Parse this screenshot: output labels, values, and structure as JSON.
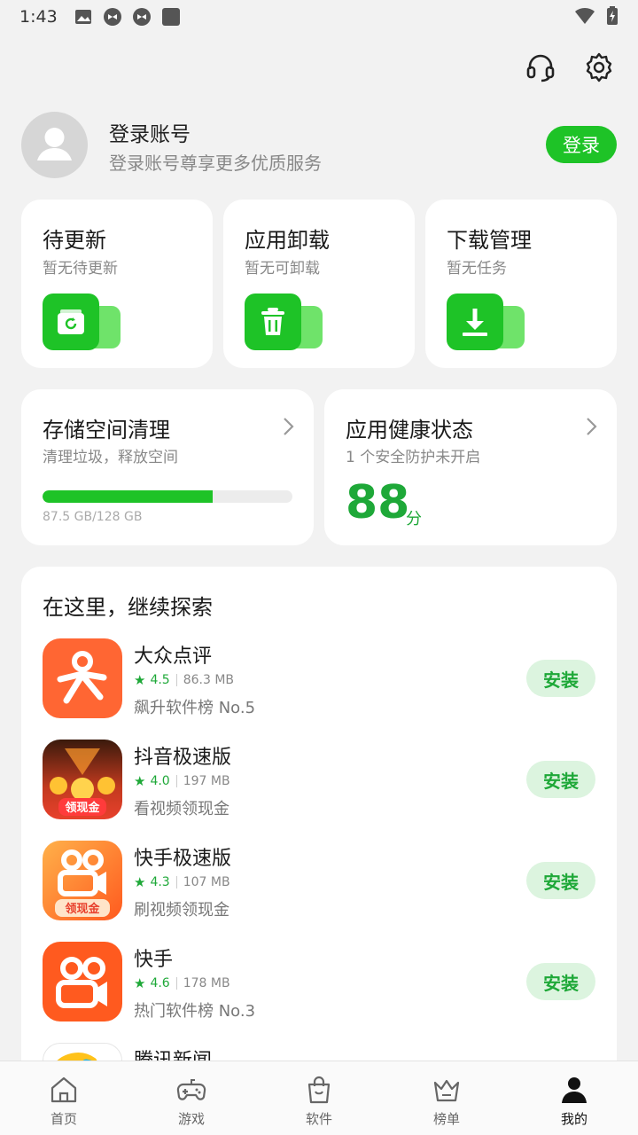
{
  "status_bar": {
    "time": "1:43",
    "icons": [
      "image-icon",
      "app-icon",
      "app-icon",
      "square-icon",
      "wifi-icon",
      "battery-charging-icon"
    ]
  },
  "top_actions": [
    "headset-icon",
    "gear-icon"
  ],
  "account": {
    "title": "登录账号",
    "subtitle": "登录账号尊享更多优质服务",
    "login_button": "登录"
  },
  "quick_actions": [
    {
      "title": "待更新",
      "subtitle": "暂无待更新",
      "icon": "refresh-icon"
    },
    {
      "title": "应用卸载",
      "subtitle": "暂无可卸载",
      "icon": "trash-icon"
    },
    {
      "title": "下载管理",
      "subtitle": "暂无任务",
      "icon": "download-icon"
    }
  ],
  "storage": {
    "title": "存储空间清理",
    "subtitle": "清理垃圾，释放空间",
    "usage_text": "87.5 GB/128 GB",
    "used_fraction": 0.68
  },
  "health": {
    "title": "应用健康状态",
    "subtitle": "1 个安全防护未开启",
    "score": "88",
    "score_unit": "分"
  },
  "explore": {
    "title": "在这里，继续探索",
    "install_label": "安装",
    "apps": [
      {
        "name": "大众点评",
        "rating": "4.5",
        "size": "86.3 MB",
        "desc": "飙升软件榜 No.5"
      },
      {
        "name": "抖音极速版",
        "rating": "4.0",
        "size": "197 MB",
        "desc": "看视频领现金",
        "badge": "领现金"
      },
      {
        "name": "快手极速版",
        "rating": "4.3",
        "size": "107 MB",
        "desc": "刷视频领现金",
        "badge": "领现金"
      },
      {
        "name": "快手",
        "rating": "4.6",
        "size": "178 MB",
        "desc": "热门软件榜 No.3"
      },
      {
        "name": "腾讯新闻"
      }
    ]
  },
  "bottom_nav": [
    {
      "label": "首页",
      "icon": "home-icon"
    },
    {
      "label": "游戏",
      "icon": "gamepad-icon"
    },
    {
      "label": "软件",
      "icon": "bag-icon"
    },
    {
      "label": "榜单",
      "icon": "crown-icon"
    },
    {
      "label": "我的",
      "icon": "person-icon",
      "active": true
    }
  ],
  "colors": {
    "accent": "#1ec327",
    "accent_dark": "#1ea838",
    "install_bg": "#dcf4df"
  }
}
